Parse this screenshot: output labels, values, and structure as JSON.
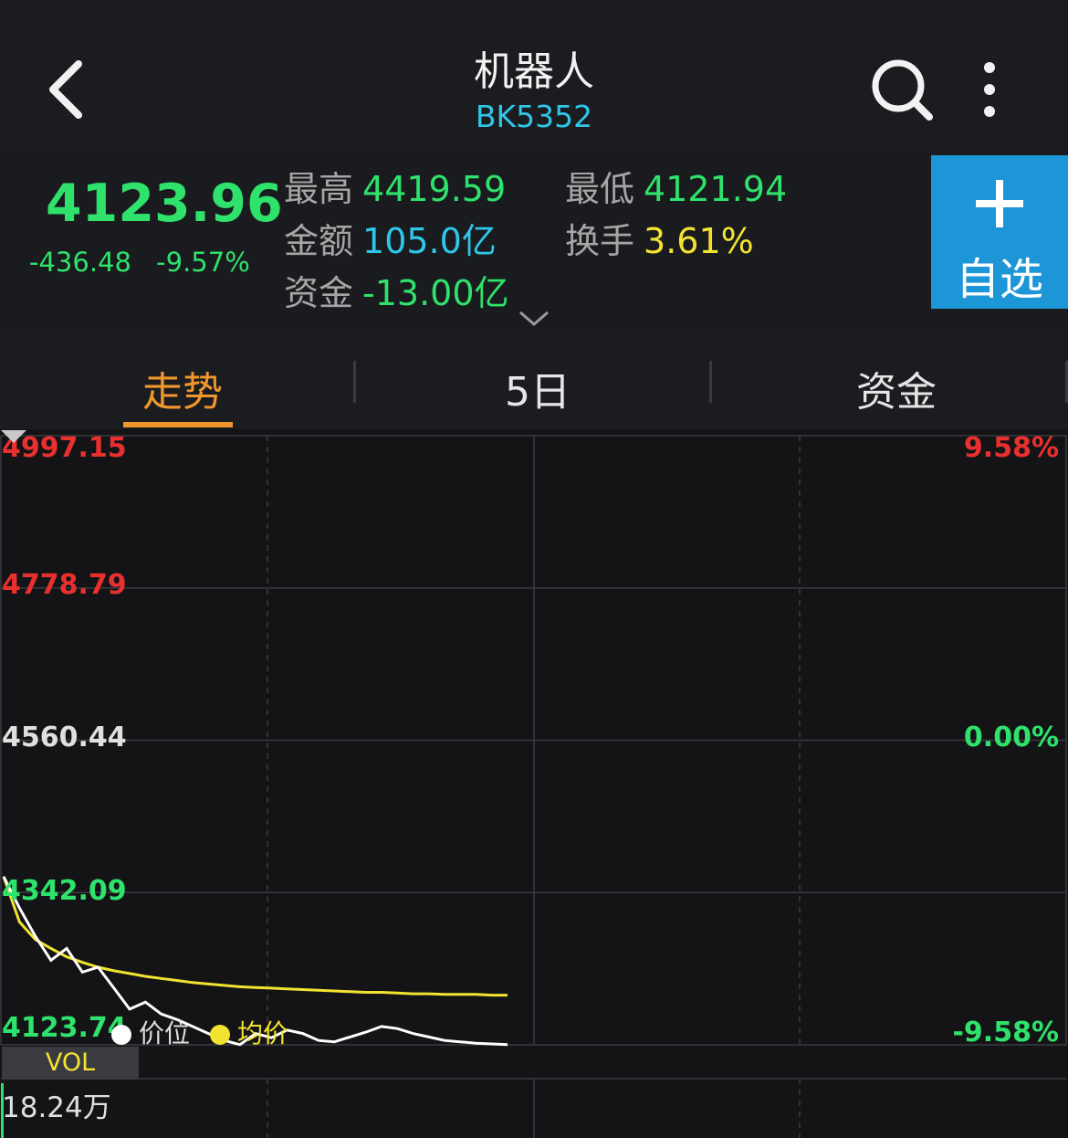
{
  "header": {
    "title": "机器人",
    "code": "BK5352"
  },
  "quote": {
    "price": "4123.96",
    "change": "-436.48",
    "change_pct": "-9.57%",
    "high_label": "最高",
    "high_value": "4419.59",
    "low_label": "最低",
    "low_value": "4121.94",
    "amount_label": "金额",
    "amount_value": "105.0亿",
    "turnover_label": "换手",
    "turnover_value": "3.61%",
    "fund_label": "资金",
    "fund_value": "-13.00亿",
    "add_watchlist_label": "自选"
  },
  "tabs": [
    {
      "label": "走势",
      "active": true
    },
    {
      "label": "5日",
      "active": false
    },
    {
      "label": "资金",
      "active": false
    }
  ],
  "chart": {
    "y_left": [
      "4997.15",
      "4778.79",
      "4560.44",
      "4342.09",
      "4123.74"
    ],
    "y_right": [
      "9.58%",
      "0.00%",
      "-9.58%"
    ],
    "legend_price": "价位",
    "legend_avg": "均价",
    "vol_label": "VOL",
    "vol_value": "18.24万",
    "colors": {
      "price_line": "#ffffff",
      "avg_line": "#f3e331",
      "up": "#e8302f",
      "down": "#2ee26b"
    }
  },
  "chart_data": {
    "type": "line",
    "ylim": [
      4123.74,
      4997.15
    ],
    "series": [
      {
        "name": "价位",
        "values": [
          4365,
          4320,
          4280,
          4245,
          4262,
          4228,
          4235,
          4205,
          4175,
          4185,
          4168,
          4160,
          4150,
          4140,
          4130,
          4124,
          4140,
          4134,
          4145,
          4140,
          4130,
          4128,
          4135,
          4142,
          4150,
          4147,
          4140,
          4135,
          4130,
          4128,
          4126,
          4125,
          4124
        ]
      },
      {
        "name": "均价",
        "values": [
          4365,
          4300,
          4275,
          4262,
          4250,
          4242,
          4235,
          4230,
          4226,
          4222,
          4219,
          4216,
          4213,
          4211,
          4209,
          4207,
          4206,
          4205,
          4204,
          4203,
          4202,
          4201,
          4200,
          4199,
          4199,
          4198,
          4197,
          4197,
          4196,
          4196,
          4196,
          4195,
          4195
        ]
      }
    ]
  }
}
